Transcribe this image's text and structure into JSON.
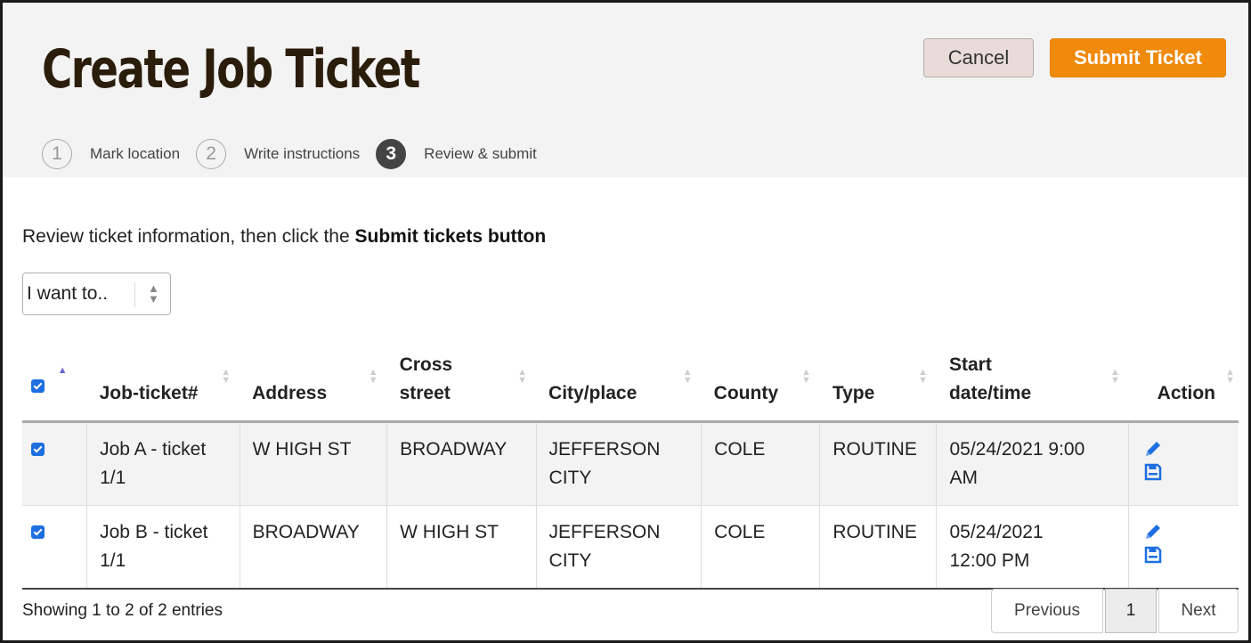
{
  "header": {
    "title": "Create Job Ticket",
    "cancel_label": "Cancel",
    "submit_label": "Submit Ticket"
  },
  "steps": [
    {
      "number": "1",
      "label": "Mark location",
      "active": false
    },
    {
      "number": "2",
      "label": "Write instructions",
      "active": false
    },
    {
      "number": "3",
      "label": "Review & submit",
      "active": true
    }
  ],
  "instructions": {
    "prefix": "Review ticket information, then click the ",
    "emphasis": "Submit tickets button"
  },
  "action_select": {
    "value": "I want to.."
  },
  "table": {
    "columns": [
      {
        "line1": "",
        "line2": "Job-ticket#"
      },
      {
        "line1": "",
        "line2": "Address"
      },
      {
        "line1": "Cross",
        "line2": "street"
      },
      {
        "line1": "",
        "line2": "City/place"
      },
      {
        "line1": "",
        "line2": "County"
      },
      {
        "line1": "",
        "line2": "Type"
      },
      {
        "line1": "Start",
        "line2": "date/time"
      },
      {
        "line1": "",
        "line2": "Action"
      }
    ],
    "rows": [
      {
        "checked": true,
        "job_line1": "Job A - ticket",
        "job_line2": "1/1",
        "address": "W HIGH ST",
        "cross_street": "BROADWAY",
        "city_line1": "JEFFERSON",
        "city_line2": "CITY",
        "county": "COLE",
        "type": "ROUTINE",
        "start_line1": "05/24/2021 9:00",
        "start_line2": "AM"
      },
      {
        "checked": true,
        "job_line1": "Job B - ticket",
        "job_line2": "1/1",
        "address": "BROADWAY",
        "cross_street": "W HIGH ST",
        "city_line1": "JEFFERSON",
        "city_line2": "CITY",
        "county": "COLE",
        "type": "ROUTINE",
        "start_line1": "05/24/2021",
        "start_line2": "12:00 PM"
      }
    ],
    "action_icons": [
      "edit-icon",
      "save-icon"
    ],
    "icon_color": "#1e6fe0"
  },
  "footer": {
    "showing": "Showing 1 to 2 of 2 entries",
    "previous_label": "Previous",
    "current_page": "1",
    "next_label": "Next"
  },
  "colors": {
    "submit_button": "#ef8a0c",
    "cancel_button": "#e9dcd8",
    "title": "#2b1d0c",
    "checkbox": "#1e6fe0"
  }
}
